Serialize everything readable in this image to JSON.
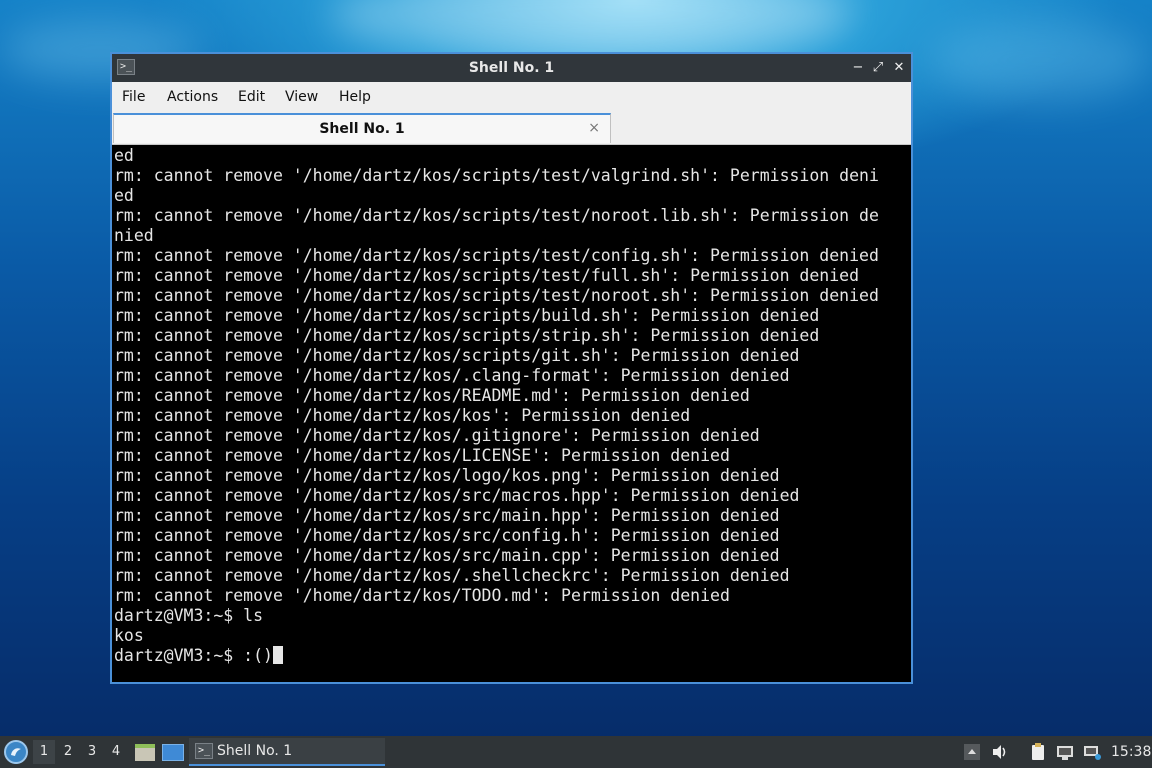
{
  "window": {
    "title": "Shell No. 1",
    "controls": {
      "minimize": "−",
      "maximize": "⤢",
      "close": "✕"
    }
  },
  "menubar": {
    "items": [
      "File",
      "Actions",
      "Edit",
      "View",
      "Help"
    ]
  },
  "tabs": [
    {
      "label": "Shell No. 1",
      "close": "×"
    }
  ],
  "terminal": {
    "lines": [
      "ed",
      "rm: cannot remove '/home/dartz/kos/scripts/test/valgrind.sh': Permission deni",
      "ed",
      "rm: cannot remove '/home/dartz/kos/scripts/test/noroot.lib.sh': Permission de",
      "nied",
      "rm: cannot remove '/home/dartz/kos/scripts/test/config.sh': Permission denied",
      "rm: cannot remove '/home/dartz/kos/scripts/test/full.sh': Permission denied",
      "rm: cannot remove '/home/dartz/kos/scripts/test/noroot.sh': Permission denied",
      "rm: cannot remove '/home/dartz/kos/scripts/build.sh': Permission denied",
      "rm: cannot remove '/home/dartz/kos/scripts/strip.sh': Permission denied",
      "rm: cannot remove '/home/dartz/kos/scripts/git.sh': Permission denied",
      "rm: cannot remove '/home/dartz/kos/.clang-format': Permission denied",
      "rm: cannot remove '/home/dartz/kos/README.md': Permission denied",
      "rm: cannot remove '/home/dartz/kos/kos': Permission denied",
      "rm: cannot remove '/home/dartz/kos/.gitignore': Permission denied",
      "rm: cannot remove '/home/dartz/kos/LICENSE': Permission denied",
      "rm: cannot remove '/home/dartz/kos/logo/kos.png': Permission denied",
      "rm: cannot remove '/home/dartz/kos/src/macros.hpp': Permission denied",
      "rm: cannot remove '/home/dartz/kos/src/main.hpp': Permission denied",
      "rm: cannot remove '/home/dartz/kos/src/config.h': Permission denied",
      "rm: cannot remove '/home/dartz/kos/src/main.cpp': Permission denied",
      "rm: cannot remove '/home/dartz/kos/.shellcheckrc': Permission denied",
      "rm: cannot remove '/home/dartz/kos/TODO.md': Permission denied",
      "dartz@VM3:~$ ls",
      "kos"
    ],
    "prompt": "dartz@VM3:~$ ",
    "current_input": ":()"
  },
  "taskbar": {
    "workspaces": [
      "1",
      "2",
      "3",
      "4"
    ],
    "active_workspace": "1",
    "task_label": "Shell No. 1",
    "clock": "15:38"
  },
  "colors": {
    "accent": "#4a90d9",
    "titlebar": "#30363b",
    "taskbar": "#2f3437",
    "terminal_bg": "#000000",
    "terminal_fg": "#e6e6e6"
  }
}
